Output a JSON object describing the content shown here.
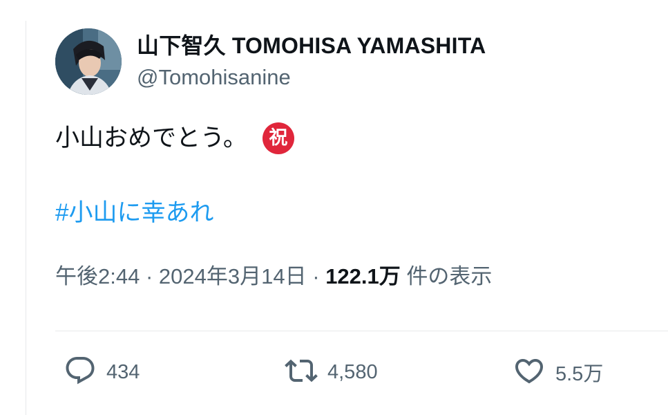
{
  "tweet": {
    "display_name": "山下智久 TOMOHISA YAMASHITA",
    "handle": "@Tomohisanine",
    "text": "小山おめでとう。",
    "emoji": "祝",
    "hashtag": "#小山に幸あれ",
    "time": "午後2:44",
    "separator": "·",
    "date": "2024年3月14日",
    "views_count": "122.1万",
    "views_label": "件の表示"
  },
  "actions": {
    "reply": {
      "icon": "reply-icon",
      "count": "434"
    },
    "retweet": {
      "icon": "retweet-icon",
      "count": "4,580"
    },
    "like": {
      "icon": "heart-icon",
      "count": "5.5万"
    }
  },
  "colors": {
    "text": "#0f1419",
    "secondary": "#536471",
    "link": "#1d9bf0",
    "emoji_bg": "#e0263b",
    "border": "#e7e9ea"
  }
}
